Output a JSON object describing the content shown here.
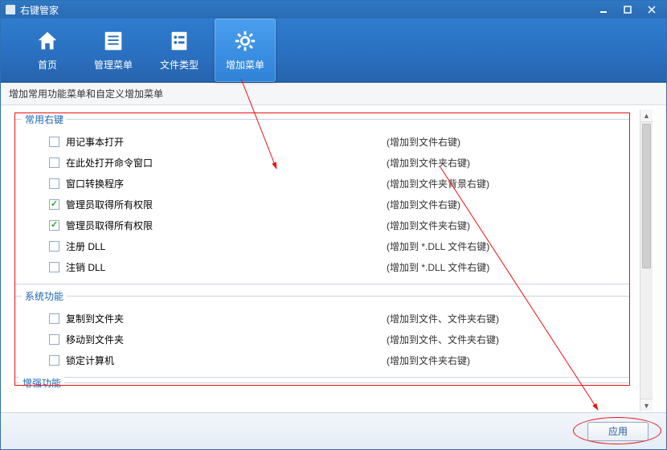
{
  "window": {
    "title": "右键管家"
  },
  "toolbar": {
    "items": [
      {
        "label": "首页",
        "icon": "home-icon",
        "active": false
      },
      {
        "label": "管理菜单",
        "icon": "list-icon",
        "active": false
      },
      {
        "label": "文件类型",
        "icon": "filetype-icon",
        "active": false
      },
      {
        "label": "增加菜单",
        "icon": "gear-icon",
        "active": true
      }
    ]
  },
  "subheader": "增加常用功能菜单和自定义增加菜单",
  "groups": [
    {
      "title": "常用右键",
      "items": [
        {
          "label": "用记事本打开",
          "checked": false,
          "desc": "(增加到文件右键)"
        },
        {
          "label": "在此处打开命令窗口",
          "checked": false,
          "desc": "(增加到文件夹右键)"
        },
        {
          "label": "窗口转换程序",
          "checked": false,
          "desc": "(增加到文件夹背景右键)"
        },
        {
          "label": "管理员取得所有权限",
          "checked": true,
          "desc": "(增加到文件右键)"
        },
        {
          "label": "管理员取得所有权限",
          "checked": true,
          "desc": "(增加到文件夹右键)"
        },
        {
          "label": "注册 DLL",
          "checked": false,
          "desc": "(增加到 *.DLL 文件右键)"
        },
        {
          "label": "注销 DLL",
          "checked": false,
          "desc": "(增加到 *.DLL 文件右键)"
        }
      ]
    },
    {
      "title": "系统功能",
      "items": [
        {
          "label": "复制到文件夹",
          "checked": false,
          "desc": "(增加到文件、文件夹右键)"
        },
        {
          "label": "移动到文件夹",
          "checked": false,
          "desc": "(增加到文件、文件夹右键)"
        },
        {
          "label": "锁定计算机",
          "checked": false,
          "desc": "(增加到文件夹右键)"
        }
      ]
    }
  ],
  "extraGroupTitle": "增强功能",
  "footer": {
    "applyLabel": "应用"
  }
}
